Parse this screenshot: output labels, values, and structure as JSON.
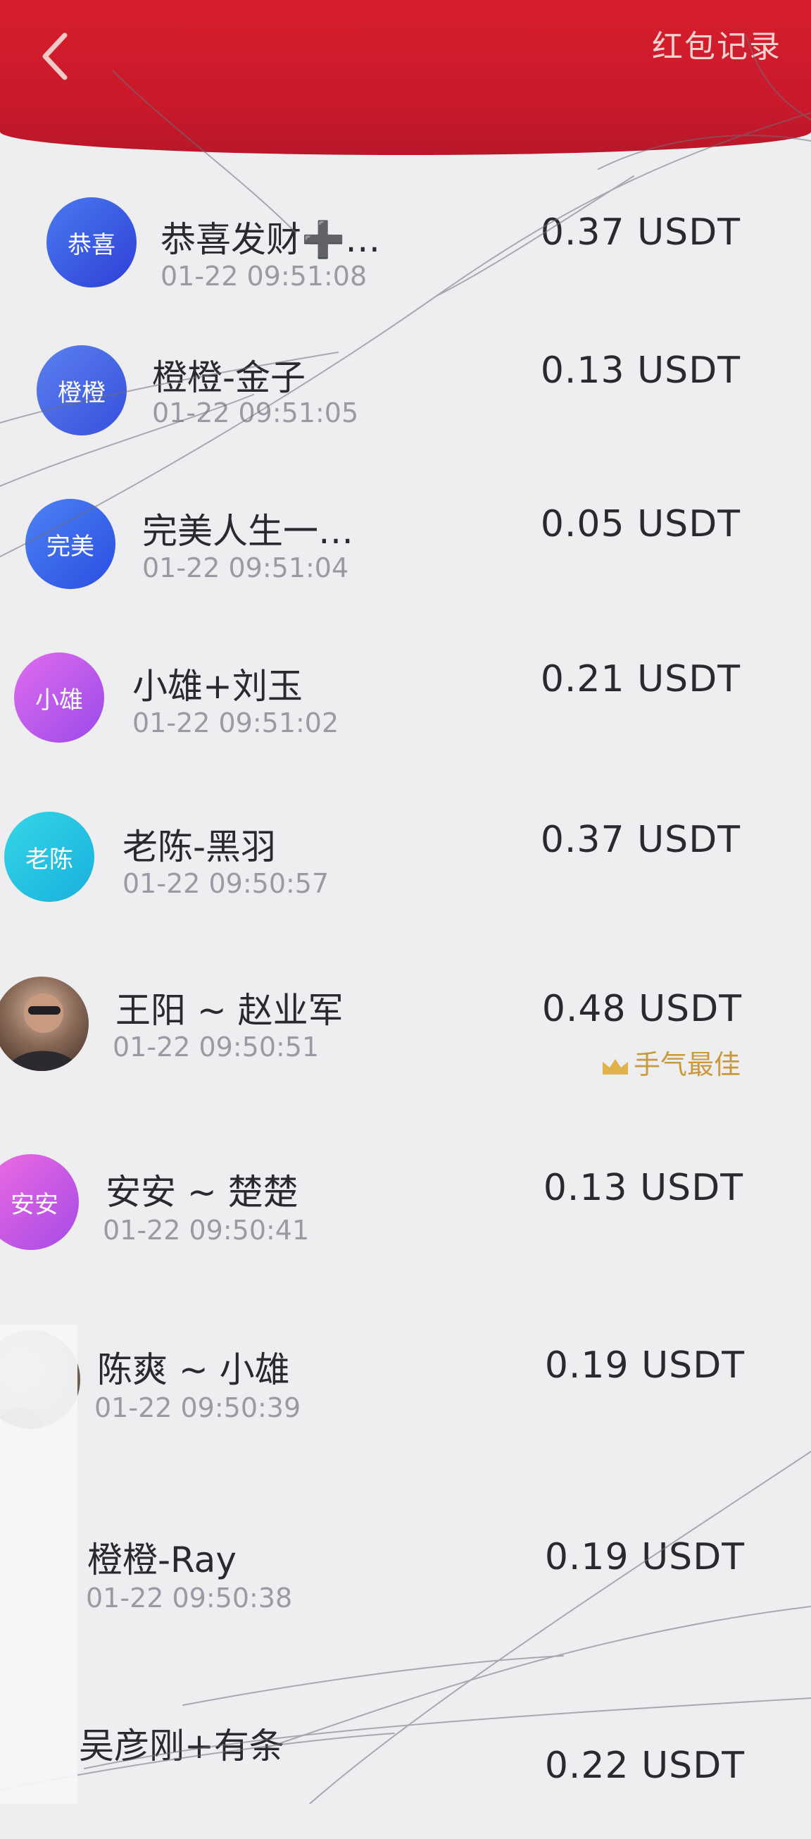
{
  "header": {
    "records_label": "红包记录"
  },
  "records": [
    {
      "avatar_text": "恭喜",
      "avatar_color": "#3a5fe0",
      "name": "恭喜发财➕…",
      "time": "01-22 09:51:08",
      "amount": "0.37  USDT"
    },
    {
      "avatar_text": "橙橙",
      "avatar_color": "#4a6ee8",
      "name": "橙橙-金子",
      "time": "01-22 09:51:05",
      "amount": "0.13  USDT"
    },
    {
      "avatar_text": "完美",
      "avatar_color": "#3c6cf0",
      "name": "完美人生一…",
      "time": "01-22 09:51:04",
      "amount": "0.05   USDT"
    },
    {
      "avatar_text": "小雄",
      "avatar_color": "#b055e8",
      "name": "小雄+刘玉",
      "time": "01-22 09:51:02",
      "amount": "0.21  USDT"
    },
    {
      "avatar_text": "老陈",
      "avatar_color": "#22c3e0",
      "name": "老陈-黑羽",
      "time": "01-22 09:50:57",
      "amount": "0.37  USDT"
    },
    {
      "avatar_text": "",
      "avatar_color": "#6a4a3a",
      "name": "王阳 ~ 赵业军",
      "time": "01-22 09:50:51",
      "amount": "0.48   USDT",
      "best_label": "手气最佳"
    },
    {
      "avatar_text": "安安",
      "avatar_color": "#c24ae0",
      "name": "安安 ~ 楚楚",
      "time": "01-22 09:50:41",
      "amount": "0.13  USDT"
    },
    {
      "avatar_text": "",
      "avatar_color": "#8a7a66",
      "name": "陈爽 ~ 小雄",
      "time": "01-22 09:50:39",
      "amount": "0.19  USDT"
    },
    {
      "avatar_text": "",
      "avatar_color": "#e8e8ec",
      "name": "橙橙-Ray",
      "time": "01-22 09:50:38",
      "amount": "0.19  USDT"
    },
    {
      "avatar_text": "",
      "avatar_color": "#e8e8ec",
      "name": "吴彦刚+有条",
      "time": "",
      "amount": "0.22  USDT"
    }
  ]
}
